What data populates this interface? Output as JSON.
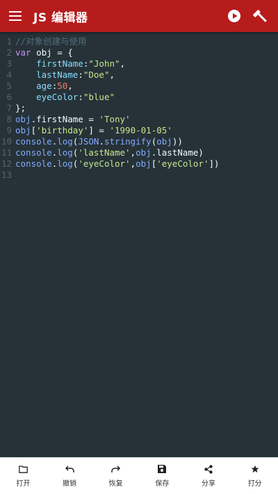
{
  "appbar": {
    "title": "JS 编辑器",
    "menu_icon": "hamburger-menu-icon",
    "run_icon": "play-circle-icon",
    "build_icon": "hammer-icon",
    "bg_color": "#b71c1c"
  },
  "editor": {
    "line_numbers": [
      "1",
      "2",
      "3",
      "4",
      "5",
      "6",
      "7",
      "8",
      "9",
      "10",
      "11",
      "12",
      "13"
    ],
    "lines": [
      [
        {
          "t": "comment",
          "v": "//对象创建与使用"
        }
      ],
      [
        {
          "t": "kw",
          "v": "var"
        },
        {
          "t": "plain",
          "v": " obj = {"
        }
      ],
      [
        {
          "t": "plain",
          "v": "    "
        },
        {
          "t": "prop",
          "v": "firstName"
        },
        {
          "t": "plain",
          "v": ":"
        },
        {
          "t": "str",
          "v": "\"John\""
        },
        {
          "t": "plain",
          "v": ","
        }
      ],
      [
        {
          "t": "plain",
          "v": "    "
        },
        {
          "t": "prop",
          "v": "lastName"
        },
        {
          "t": "plain",
          "v": ":"
        },
        {
          "t": "str",
          "v": "\"Doe\""
        },
        {
          "t": "plain",
          "v": ","
        }
      ],
      [
        {
          "t": "plain",
          "v": "    "
        },
        {
          "t": "prop",
          "v": "age"
        },
        {
          "t": "plain",
          "v": ":"
        },
        {
          "t": "num",
          "v": "50"
        },
        {
          "t": "plain",
          "v": ","
        }
      ],
      [
        {
          "t": "plain",
          "v": "    "
        },
        {
          "t": "prop",
          "v": "eyeColor"
        },
        {
          "t": "plain",
          "v": ":"
        },
        {
          "t": "str",
          "v": "\"blue\""
        }
      ],
      [
        {
          "t": "plain",
          "v": "};"
        }
      ],
      [
        {
          "t": "obj",
          "v": "obj"
        },
        {
          "t": "plain",
          "v": ".firstName = "
        },
        {
          "t": "str",
          "v": "'Tony'"
        }
      ],
      [
        {
          "t": "obj",
          "v": "obj"
        },
        {
          "t": "plain",
          "v": "["
        },
        {
          "t": "str",
          "v": "'birthday'"
        },
        {
          "t": "plain",
          "v": "] = "
        },
        {
          "t": "str",
          "v": "'1990-01-05'"
        }
      ],
      [
        {
          "t": "fn",
          "v": "console"
        },
        {
          "t": "plain",
          "v": "."
        },
        {
          "t": "fn",
          "v": "log"
        },
        {
          "t": "plain",
          "v": "("
        },
        {
          "t": "fn",
          "v": "JSON"
        },
        {
          "t": "plain",
          "v": "."
        },
        {
          "t": "fn",
          "v": "stringify"
        },
        {
          "t": "plain",
          "v": "("
        },
        {
          "t": "obj",
          "v": "obj"
        },
        {
          "t": "plain",
          "v": "))"
        }
      ],
      [
        {
          "t": "fn",
          "v": "console"
        },
        {
          "t": "plain",
          "v": "."
        },
        {
          "t": "fn",
          "v": "log"
        },
        {
          "t": "plain",
          "v": "("
        },
        {
          "t": "str",
          "v": "'lastName'"
        },
        {
          "t": "plain",
          "v": ","
        },
        {
          "t": "obj",
          "v": "obj"
        },
        {
          "t": "plain",
          "v": ".lastName)"
        }
      ],
      [
        {
          "t": "fn",
          "v": "console"
        },
        {
          "t": "plain",
          "v": "."
        },
        {
          "t": "fn",
          "v": "log"
        },
        {
          "t": "plain",
          "v": "("
        },
        {
          "t": "str",
          "v": "'eyeColor'"
        },
        {
          "t": "plain",
          "v": ","
        },
        {
          "t": "obj",
          "v": "obj"
        },
        {
          "t": "plain",
          "v": "["
        },
        {
          "t": "str",
          "v": "'eyeColor'"
        },
        {
          "t": "plain",
          "v": "])"
        }
      ],
      []
    ]
  },
  "toolbar": {
    "items": [
      {
        "label": "打开",
        "icon": "folder-icon"
      },
      {
        "label": "撤销",
        "icon": "undo-icon"
      },
      {
        "label": "恢复",
        "icon": "redo-icon"
      },
      {
        "label": "保存",
        "icon": "save-icon"
      },
      {
        "label": "分享",
        "icon": "share-icon"
      },
      {
        "label": "打分",
        "icon": "star-icon"
      }
    ]
  }
}
